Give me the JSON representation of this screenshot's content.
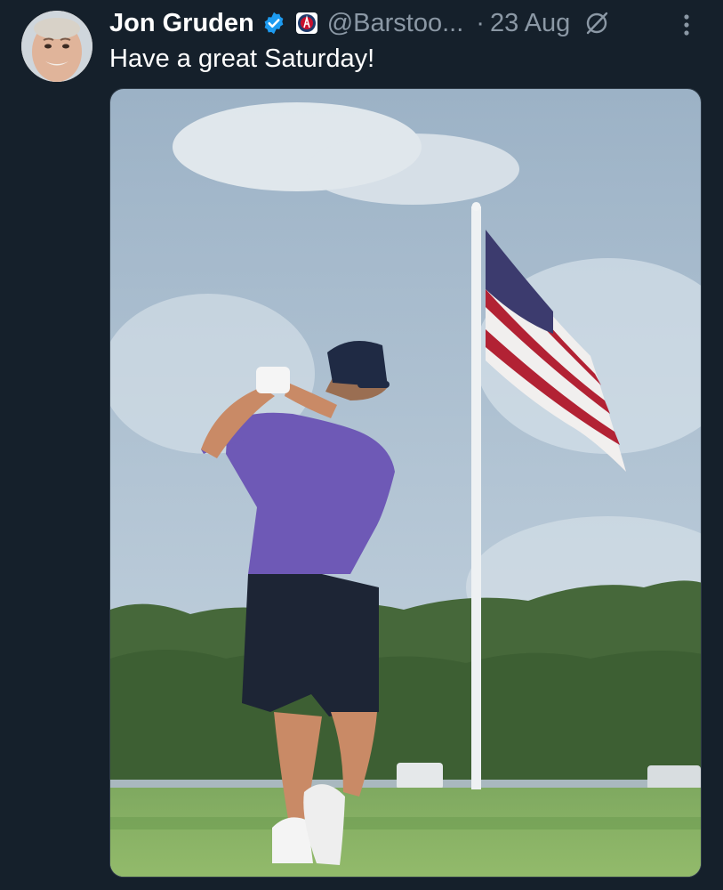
{
  "tweet": {
    "author_name": "Jon Gruden",
    "handle": "@Barstoo...",
    "separator": "·",
    "timestamp": "23 Aug",
    "text": "Have a great Saturday!",
    "verified_icon": "verified-badge-icon",
    "affiliation_icon": "affiliate-badge-icon",
    "grok_icon": "grok-icon",
    "more_icon": "more-vertical-icon"
  },
  "colors": {
    "background": "#15202b",
    "text_primary": "#ffffff",
    "text_secondary": "#8b98a5",
    "verified_blue": "#1d9bf0"
  }
}
